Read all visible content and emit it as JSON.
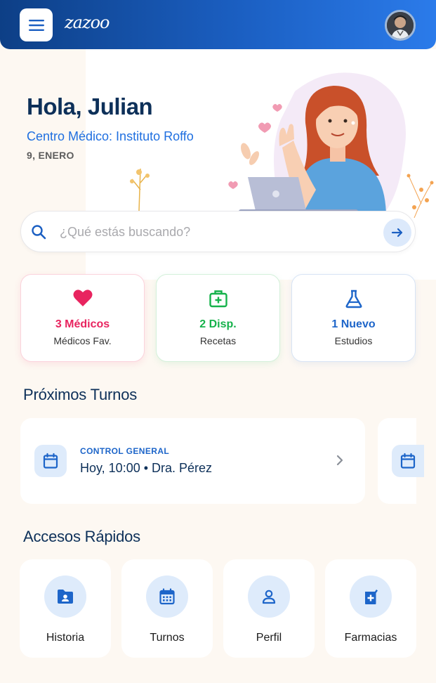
{
  "header": {
    "logo": "zazoo",
    "menu_icon": "hamburger-menu-icon",
    "avatar": "user-avatar"
  },
  "hero": {
    "greeting": "Hola, Julian",
    "center": "Centro Médico: Instituto Roffo",
    "date": "9, ENERO"
  },
  "search": {
    "placeholder": "¿Qué estás buscando?",
    "icon": "search-icon",
    "button_icon": "arrow-right-icon"
  },
  "stats": [
    {
      "value": "3 Médicos",
      "label": "Médicos Fav.",
      "icon": "heart-icon",
      "color": "#e8245f"
    },
    {
      "value": "2 Disp.",
      "label": "Recetas",
      "icon": "medkit-icon",
      "color": "#16b24b"
    },
    {
      "value": "1 Nuevo",
      "label": "Estudios",
      "icon": "flask-icon",
      "color": "#1d65c9"
    }
  ],
  "turnos": {
    "title": "Próximos Turnos",
    "items": [
      {
        "category": "CONTROL GENERAL",
        "summary": "Hoy, 10:00 • Dra. Pérez",
        "icon": "calendar-icon"
      }
    ]
  },
  "accesos": {
    "title": "Accesos Rápidos",
    "items": [
      {
        "label": "Historia",
        "icon": "folder-user-icon"
      },
      {
        "label": "Turnos",
        "icon": "calendar-grid-icon"
      },
      {
        "label": "Perfil",
        "icon": "person-icon"
      },
      {
        "label": "Farmacias",
        "icon": "pharmacy-icon"
      }
    ]
  },
  "colors": {
    "primary": "#1d65c9",
    "header_start": "#0d3f86",
    "header_end": "#2b7bea",
    "heading": "#0d3059",
    "pink": "#e8245f",
    "green": "#16b24b"
  }
}
